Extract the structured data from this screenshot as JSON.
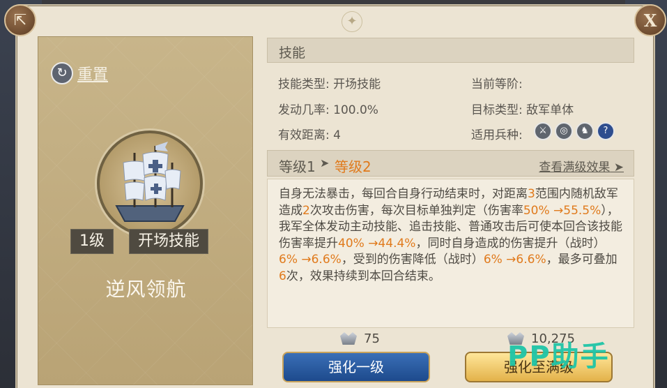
{
  "panel": {
    "ornament": "✦"
  },
  "left": {
    "reset_label": "重置",
    "level_badge": "1级",
    "type_badge": "开场技能",
    "skill_name": "逆风领航"
  },
  "info": {
    "section_title": "技能",
    "skill_type_label": "技能类型:",
    "skill_type_value": "开场技能",
    "current_tier_label": "当前等阶:",
    "trigger_rate_label": "发动几率:",
    "trigger_rate_value": "100.0%",
    "target_type_label": "目标类型:",
    "target_type_value": "敌军单体",
    "range_label": "有效距离:",
    "range_value": "4",
    "unit_types_label": "适用兵种:",
    "unit_icons": [
      "sword-icon",
      "target-icon",
      "horse-icon",
      "help-icon"
    ]
  },
  "levels": {
    "level1": "等级1",
    "level2": "等级2",
    "view_max": "查看满级效果"
  },
  "description": {
    "p1": "自身无法暴击，每回合自身行动结束时，对距离",
    "n1": "3",
    "p2": "范围内随机敌军造成",
    "n2": "2",
    "p3": "次攻击伤害，每次目标单独判定（伤害率",
    "n3": "50% →55.5%",
    "p4": "），我军全体发动主动技能、追击技能、普通攻击后可使本回合该技能伤害率提升",
    "n4": "40% →44.4%",
    "p5": "，同时自身造成的伤害提升（战时）",
    "n5": "6% →6.6%",
    "p6": "，受到的伤害降低（战时）",
    "n6": "6% →6.6%",
    "p7": "，最多可叠加",
    "n7": "6",
    "p8": "次，效果持续到本回合结束。"
  },
  "costs": {
    "upgrade_one_cost": "75",
    "upgrade_max_cost": "10,275"
  },
  "buttons": {
    "upgrade_one": "强化一级",
    "upgrade_max": "强化至满级"
  },
  "watermark": "PP助手",
  "colors": {
    "highlight": "#e07a1c",
    "panel_bg": "#ece4d3",
    "card_bg": "#c8b58a"
  }
}
